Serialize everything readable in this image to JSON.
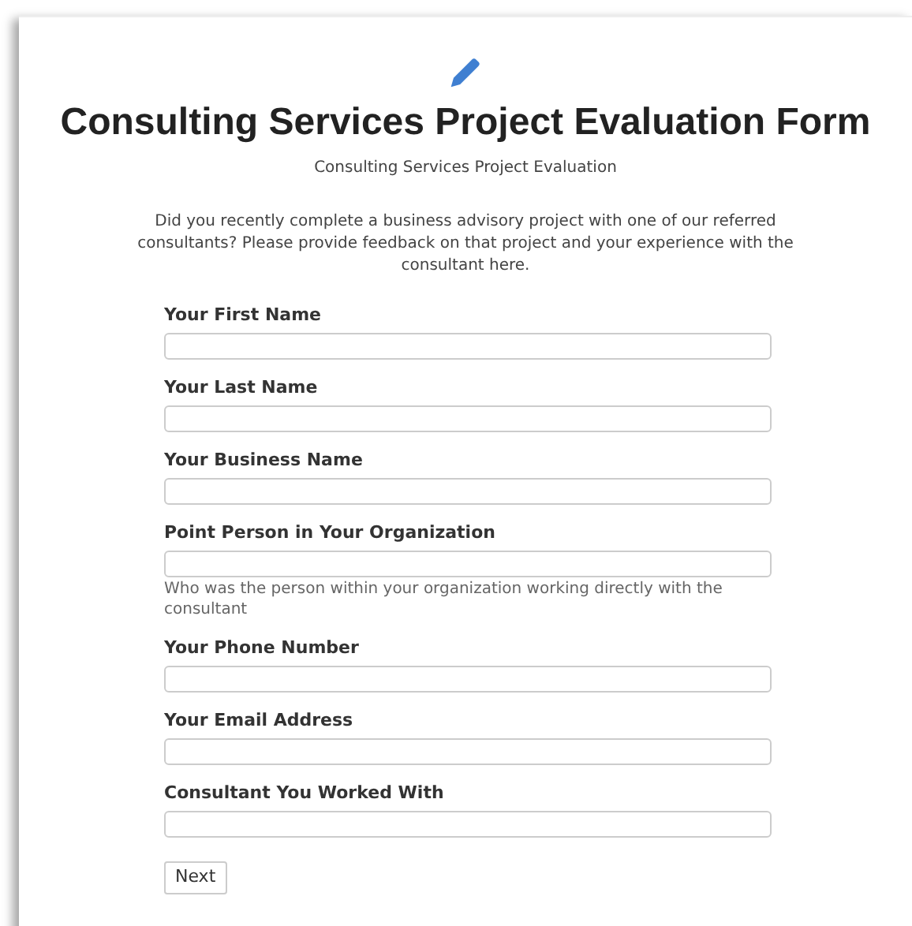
{
  "form": {
    "title": "Consulting Services Project Evaluation Form",
    "subtitle": "Consulting Services Project Evaluation",
    "description": "Did you recently complete a business advisory project with one of our referred consultants? Please provide feedback on that project and your experience with the consultant here.",
    "fields": [
      {
        "label": "Your First Name"
      },
      {
        "label": "Your Last Name"
      },
      {
        "label": "Your Business Name"
      },
      {
        "label": "Point Person in Your Organization",
        "help": "Who was the person within your organization working directly with the consultant"
      },
      {
        "label": "Your Phone Number"
      },
      {
        "label": "Your Email Address"
      },
      {
        "label": "Consultant You Worked With"
      }
    ],
    "next_button": "Next"
  }
}
